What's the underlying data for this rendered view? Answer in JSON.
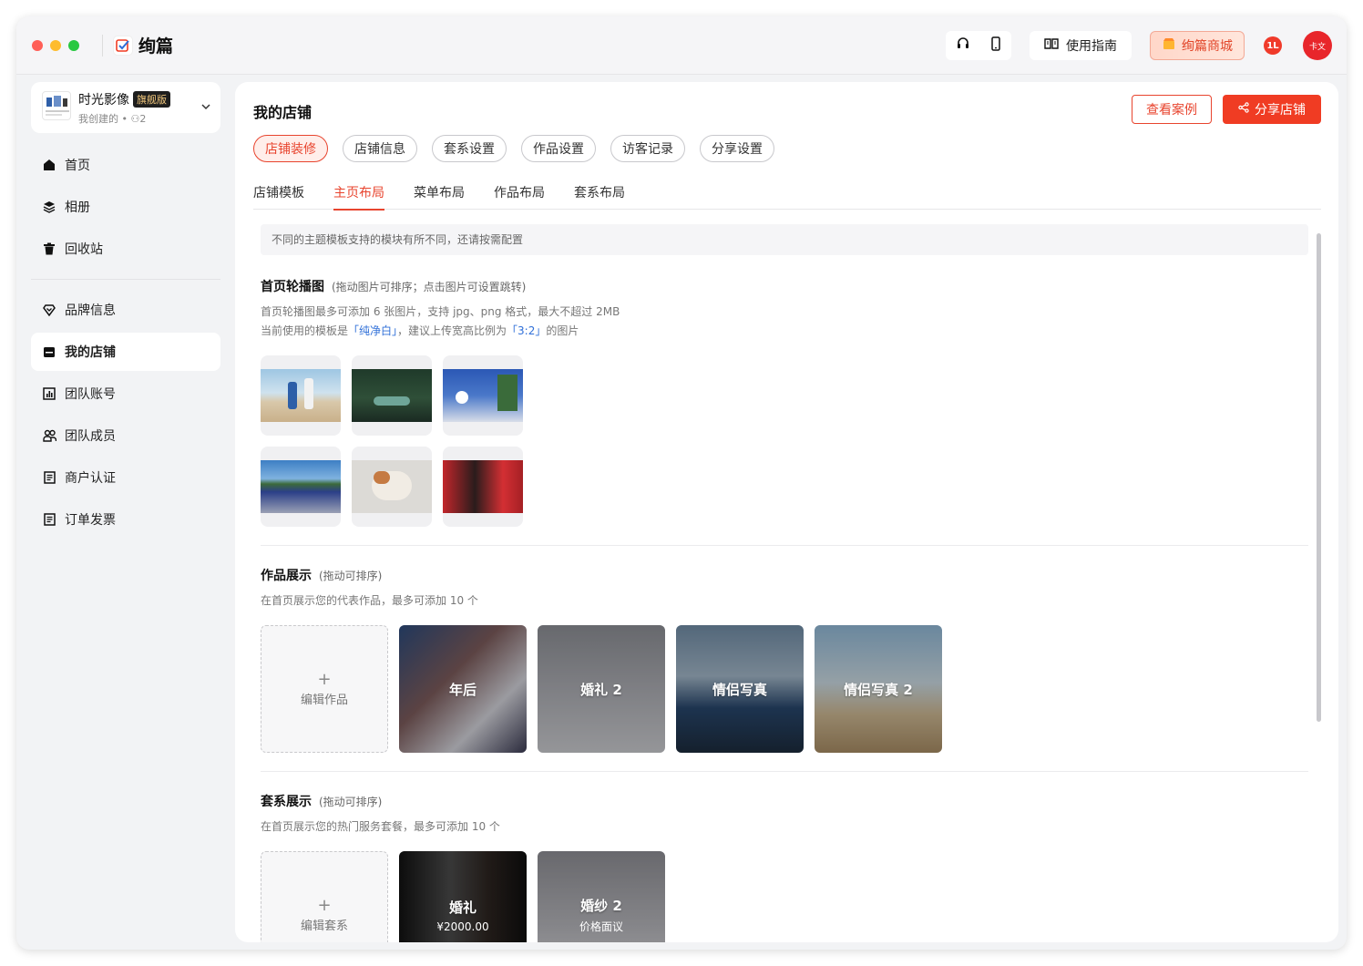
{
  "app": {
    "name": "绚篇"
  },
  "titlebar": {
    "guide_label": "使用指南",
    "mall_label": "绚篇商城",
    "notify_label": "1L",
    "avatar_label": "卡文"
  },
  "studio": {
    "name": "时光影像",
    "badge": "旗舰版",
    "sub": "我创建的 • ⚇2"
  },
  "sidebar": {
    "group1": [
      {
        "label": "首页",
        "icon": "home-icon"
      },
      {
        "label": "相册",
        "icon": "layers-icon"
      },
      {
        "label": "回收站",
        "icon": "trash-icon"
      }
    ],
    "group2": [
      {
        "label": "品牌信息",
        "icon": "diamond-icon"
      },
      {
        "label": "我的店铺",
        "icon": "store-icon",
        "active": true
      },
      {
        "label": "团队账号",
        "icon": "chart-icon"
      },
      {
        "label": "团队成员",
        "icon": "team-icon"
      },
      {
        "label": "商户认证",
        "icon": "document-icon"
      },
      {
        "label": "订单发票",
        "icon": "invoice-icon"
      }
    ]
  },
  "main": {
    "title": "我的店铺",
    "view_cases": "查看案例",
    "share_store": "分享店铺",
    "pills": [
      "店铺装修",
      "店铺信息",
      "套系设置",
      "作品设置",
      "访客记录",
      "分享设置"
    ],
    "subtabs": [
      "店铺模板",
      "主页布局",
      "菜单布局",
      "作品布局",
      "套系布局"
    ],
    "tip": "不同的主题模板支持的模块有所不同，还请按需配置"
  },
  "banner": {
    "title": "首页轮播图",
    "hint": "(拖动图片可排序；点击图片可设置跳转)",
    "desc1": "首页轮播图最多可添加 6 张图片，支持 jpg、png 格式，最大不超过 2MB",
    "desc2_prefix": "当前使用的模板是",
    "template_name": "「纯净白」",
    "desc2_mid": "，建议上传宽高比例为",
    "ratio": "「3:2」",
    "desc2_suffix": "的图片"
  },
  "works": {
    "title": "作品展示",
    "hint": "(拖动可排序)",
    "desc": "在首页展示您的代表作品，最多可添加 10 个",
    "add_label": "编辑作品",
    "items": [
      "年后",
      "婚礼 2",
      "情侣写真",
      "情侣写真 2"
    ]
  },
  "packages": {
    "title": "套系展示",
    "hint": "(拖动可排序)",
    "desc": "在首页展示您的热门服务套餐，最多可添加 10 个",
    "add_label": "编辑套系",
    "items": [
      {
        "name": "婚礼",
        "price": "¥2000.00"
      },
      {
        "name": "婚纱 2",
        "price": "价格面议"
      }
    ]
  },
  "colors": {
    "accent": "#f03c23",
    "link": "#2f6fd8"
  }
}
